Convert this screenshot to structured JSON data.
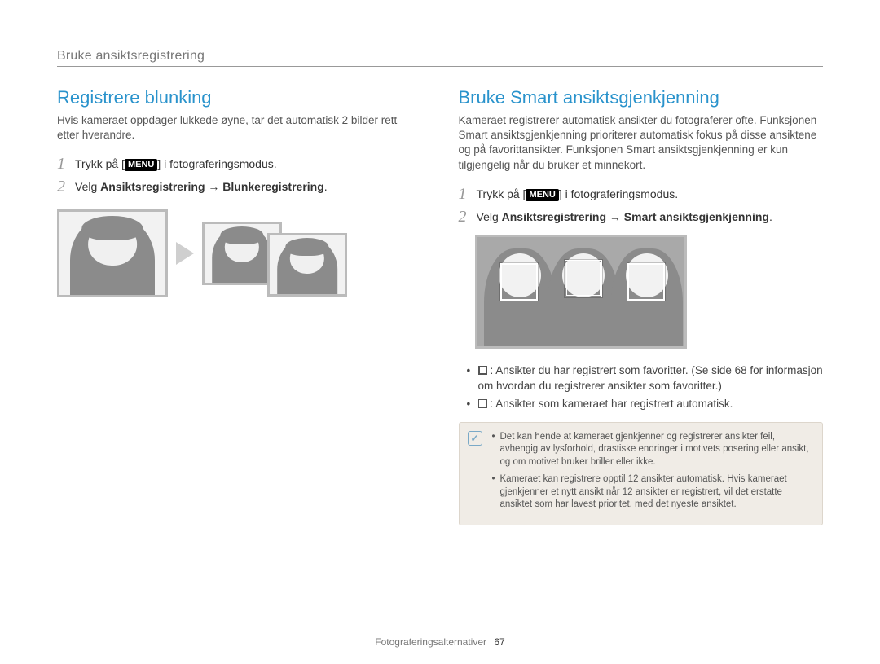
{
  "header": {
    "breadcrumb": "Bruke ansiktsregistrering"
  },
  "menu_badge": "MENU",
  "left": {
    "title": "Registrere blunking",
    "desc": "Hvis kameraet oppdager lukkede øyne, tar det automatisk 2 bilder rett etter hverandre.",
    "steps": {
      "s1_pre": "Trykk på [",
      "s1_post": "] i fotograferingsmodus.",
      "s2_pre": "Velg ",
      "s2_bold": "Ansiktsregistrering → Blunkeregistrering",
      "s2_post": "."
    }
  },
  "right": {
    "title": "Bruke Smart ansiktsgjenkjenning",
    "desc": "Kameraet registrerer automatisk ansikter du fotograferer ofte. Funksjonen Smart ansiktsgjenkjenning prioriterer automatisk fokus på disse ansiktene og på favorittansikter. Funksjonen Smart ansiktsgjenkjenning er kun tilgjengelig når du bruker et minnekort.",
    "steps": {
      "s1_pre": "Trykk på [",
      "s1_post": "] i fotograferingsmodus.",
      "s2_pre": "Velg ",
      "s2_bold": "Ansiktsregistrering → Smart ansiktsgjenkjenning",
      "s2_post": "."
    },
    "bullets": {
      "b1": ": Ansikter du har registrert som favoritter. (Se side 68 for informasjon om hvordan du registrerer ansikter som favoritter.)",
      "b2": ": Ansikter som kameraet har registrert automatisk."
    },
    "note": {
      "n1": "Det kan hende at kameraet gjenkjenner og registrerer ansikter feil, avhengig av lysforhold, drastiske endringer i motivets posering eller ansikt, og om motivet bruker briller eller ikke.",
      "n2": "Kameraet kan registrere opptil 12 ansikter automatisk. Hvis kameraet gjenkjenner et nytt ansikt når 12 ansikter er registrert, vil det erstatte ansiktet som har lavest prioritet, med det nyeste ansiktet."
    }
  },
  "footer": {
    "section": "Fotograferingsalternativer",
    "page": "67"
  },
  "icons": {
    "note": "✓",
    "arrow": "arrow-right-icon",
    "fav_box": "favorite-face-box-icon",
    "auto_box": "auto-face-box-icon"
  }
}
